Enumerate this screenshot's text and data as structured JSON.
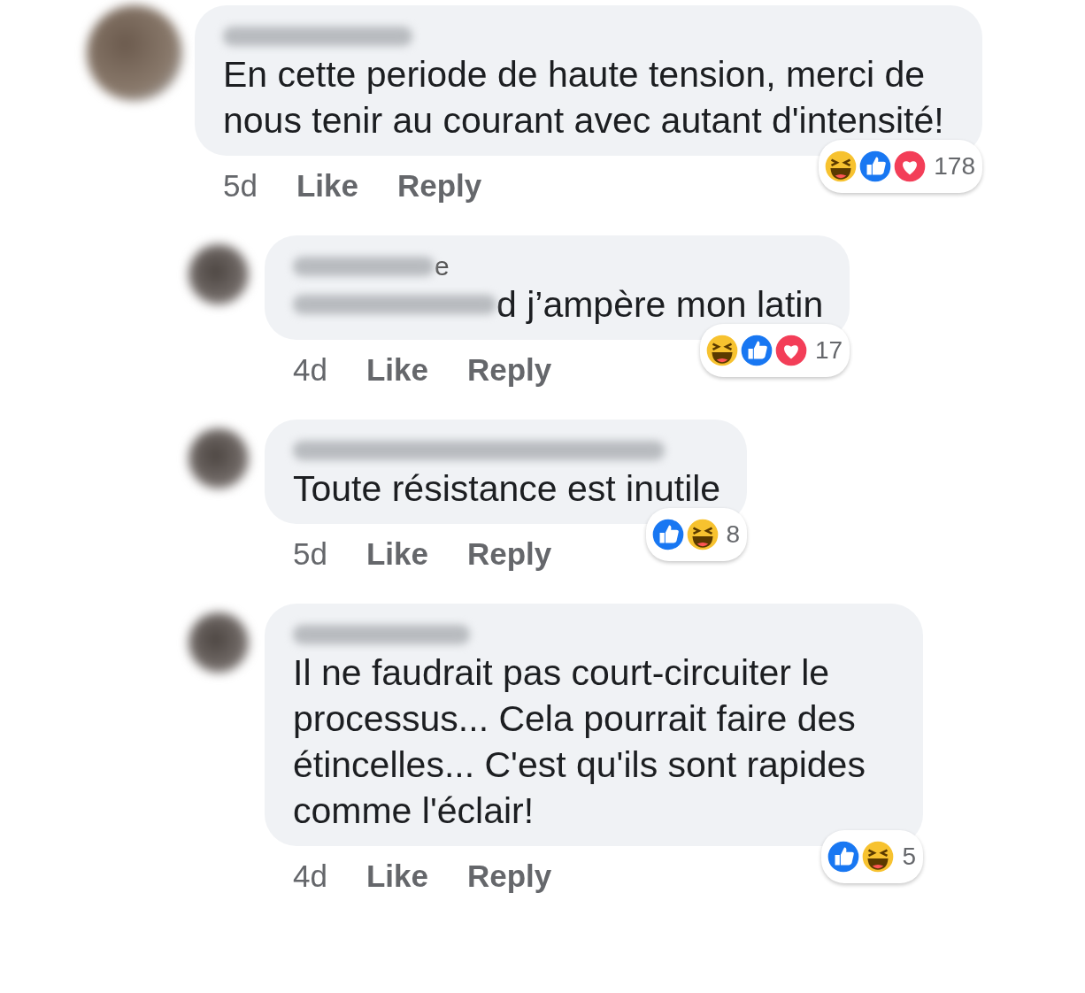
{
  "comments": [
    {
      "kind": "comment",
      "text_prefix_blurred": false,
      "text": "En cette periode de haute tension, merci de nous tenir au courant avec autant d'intensité!",
      "time": "5d",
      "like": "Like",
      "reply": "Reply",
      "reactions": [
        {
          "kind": "haha"
        },
        {
          "kind": "like"
        },
        {
          "kind": "love"
        }
      ],
      "reaction_count": "178"
    },
    {
      "kind": "reply",
      "name_tail": "e",
      "text_prefix_blurred": true,
      "text": "d j’ampère mon latin",
      "time": "4d",
      "like": "Like",
      "reply": "Reply",
      "reactions": [
        {
          "kind": "haha"
        },
        {
          "kind": "like"
        },
        {
          "kind": "love"
        }
      ],
      "reaction_count": "17"
    },
    {
      "kind": "reply",
      "text_prefix_blurred": false,
      "text": "Toute résistance est inutile",
      "time": "5d",
      "like": "Like",
      "reply": "Reply",
      "reactions": [
        {
          "kind": "like"
        },
        {
          "kind": "haha"
        }
      ],
      "reaction_count": "8"
    },
    {
      "kind": "reply",
      "text_prefix_blurred": false,
      "text": "Il ne faudrait pas court-circuiter le processus... Cela pourrait faire des étincelles... C'est qu'ils sont rapides comme l'éclair!",
      "time": "4d",
      "like": "Like",
      "reply": "Reply",
      "reactions": [
        {
          "kind": "like"
        },
        {
          "kind": "haha"
        }
      ],
      "reaction_count": "5"
    }
  ]
}
